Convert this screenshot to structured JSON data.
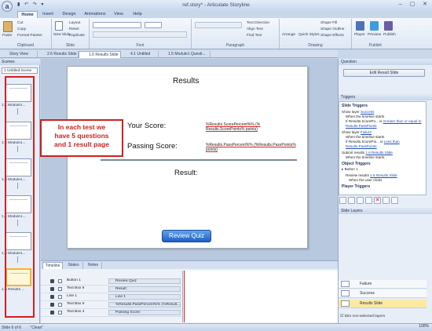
{
  "window": {
    "title": "ref.story* - Articulate Storyline",
    "app_button": "a"
  },
  "ribbon_tabs": [
    "Home",
    "Insert",
    "Design",
    "Animations",
    "View",
    "Help"
  ],
  "ribbon": {
    "clipboard": {
      "paste": "Paste",
      "cut": "Cut",
      "copy": "Copy",
      "format_painter": "Format Painter",
      "label": "Clipboard"
    },
    "slide": {
      "new_slide": "New Slide",
      "layout": "Layout",
      "reset": "Reset",
      "duplicate": "Duplicate",
      "label": "Slide"
    },
    "font": {
      "label": "Font"
    },
    "paragraph": {
      "text_direction": "Text Direction",
      "align_text": "Align Text",
      "find_text": "Find Text",
      "label": "Paragraph"
    },
    "drawing": {
      "arrange": "Arrange",
      "quick_styles": "Quick Styles",
      "shape_fill": "Shape Fill",
      "shape_outline": "Shape Outline",
      "shape_effects": "Shape Effects",
      "label": "Drawing"
    },
    "publish": {
      "player": "Player",
      "preview": "Preview",
      "publish": "Publish",
      "label": "Publish"
    }
  },
  "doc_tabs": [
    "Story View",
    "2.6 Results Slide",
    "1.6 Results Slide",
    "4.1 Untitled Slide",
    "1.5 Module1 Questi..."
  ],
  "scenes": {
    "title": "Scenes",
    "selected_scene": "1 Untitled Scene",
    "thumbnails": [
      "1.1 Module1...",
      "1.2 Module1...",
      "1.3 Module1...",
      "1.4 Module1...",
      "1.5 Module1...",
      "1.6 Results ..."
    ]
  },
  "slide": {
    "title": "Results",
    "your_score_label": "Your Score:",
    "your_score_var_line1": "%Results.ScorePercent%% (%",
    "your_score_var_line2": "Results.ScorePoints% points)",
    "passing_score_label": "Passing Score:",
    "passing_score_var_line1": "%Results.PassPercent%% (%Results.PassPoints%",
    "passing_score_var_line2": "points)",
    "result_label": "Result:",
    "review_button": "Review Quiz"
  },
  "callout": {
    "line1": "In each test we",
    "line2": "have 5 questions",
    "line3": "and 1 result page"
  },
  "timeline": {
    "tabs": [
      "Timeline",
      "States",
      "Notes"
    ],
    "rows": [
      {
        "name": "Button 1",
        "bar": "Review Quiz"
      },
      {
        "name": "Text Box 6",
        "bar": "Result:"
      },
      {
        "name": "Line 1",
        "bar": "Line 1"
      },
      {
        "name": "Text Box 5",
        "bar": "%Results.PassPercent%% (%Result..."
      },
      {
        "name": "Text Box 4",
        "bar": "Passing Score:"
      }
    ]
  },
  "right_panel": {
    "question_title": "Question",
    "edit_result_button": "Edit Result Slide",
    "triggers_title": "Triggers",
    "slide_triggers": "Slide Triggers",
    "trigger1": {
      "action": "Show layer",
      "target": "Success",
      "when": "When the timeline starts",
      "cond_prefix": "If Results.ScorePo... is",
      "cond_op": "Greater than or equal to",
      "cond_value": "Results.PassPoints"
    },
    "trigger2": {
      "action": "Show layer",
      "target": "Failure",
      "when": "When the timeline starts",
      "cond_prefix": "If Results.ScorePoi... is",
      "cond_op": "Less than",
      "cond_value": "Results.PassPoints"
    },
    "trigger3": {
      "action": "Submit results",
      "target": "1.6 Results Slide",
      "when": "When the timeline starts"
    },
    "object_triggers": "Object Triggers",
    "button1": "Button 1",
    "trigger4": {
      "action": "Review results",
      "target": "1.6 Results Slide",
      "when": "When the user clicks"
    },
    "player_triggers": "Player Triggers",
    "slide_layers_title": "Slide Layers",
    "layers": [
      "Failure",
      "Success",
      "Results Slide"
    ],
    "dim_label": "Dim non-selected layers"
  },
  "status": {
    "slide_of": "Slide 6 of 6",
    "theme": "\"Clean\"",
    "zoom": "100%"
  }
}
